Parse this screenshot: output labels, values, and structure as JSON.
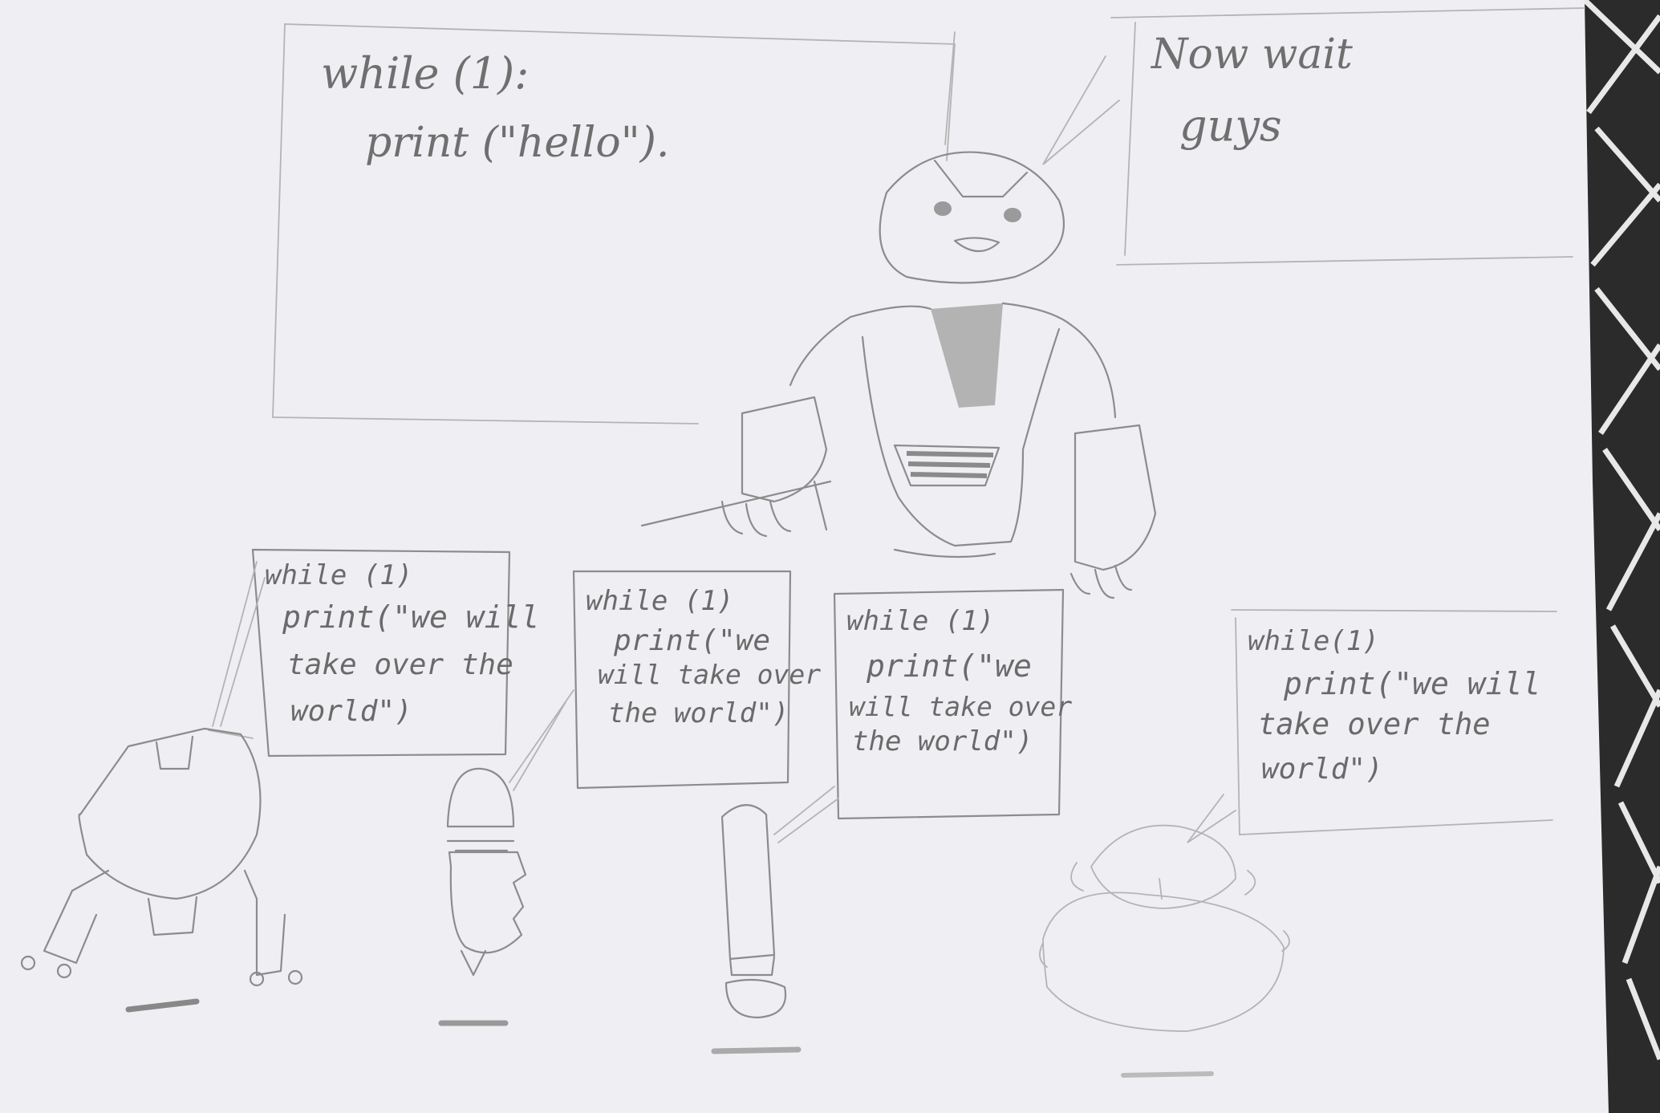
{
  "image": {
    "background_color": "#2b2b2b",
    "paper_color": "#efeff3",
    "pencil_color": "#8c8c8c"
  },
  "board": {
    "line1": "while (1):",
    "line2": "print (\"hello\")."
  },
  "teacher_bubble": {
    "line1": "Now wait",
    "line2": "guys"
  },
  "bubble_1": {
    "line1": "while (1)",
    "line2": "print(\"we will",
    "line3": "take over the",
    "line4": "world\")"
  },
  "bubble_2": {
    "line1": "while (1)",
    "line2": "print(\"we",
    "line3": "will take over",
    "line4": "the world\")"
  },
  "bubble_3": {
    "line1": "while (1)",
    "line2": "print(\"we",
    "line3": "will take over",
    "line4": "the world\")"
  },
  "bubble_4": {
    "line1": "while(1)",
    "line2": "print(\"we will",
    "line3": "take over the",
    "line4": "world\")"
  }
}
